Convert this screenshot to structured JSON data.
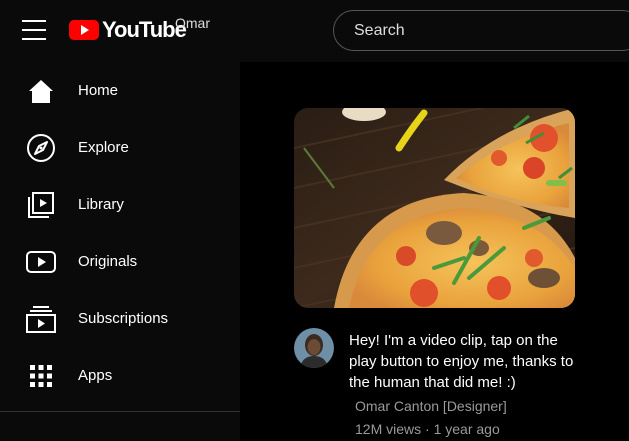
{
  "header": {
    "logo_text": "YouTube",
    "user_name": "Omar",
    "search_placeholder": "Search"
  },
  "sidebar": {
    "items": [
      {
        "label": "Home",
        "icon": "home-icon"
      },
      {
        "label": "Explore",
        "icon": "compass-icon"
      },
      {
        "label": "Library",
        "icon": "library-icon"
      },
      {
        "label": "Originals",
        "icon": "originals-icon"
      },
      {
        "label": "Subscriptions",
        "icon": "subscriptions-icon"
      },
      {
        "label": "Apps",
        "icon": "apps-grid-icon"
      }
    ]
  },
  "video": {
    "title": "Hey! I'm a video clip, tap on the play button to enjoy me, thanks to the human that did me! :)",
    "channel": "Omar Canton [Designer]",
    "meta": "12M views · 1 year ago"
  },
  "colors": {
    "brand_red": "#ff0000",
    "background": "#000000",
    "secondary_text": "#9a9a9a"
  }
}
